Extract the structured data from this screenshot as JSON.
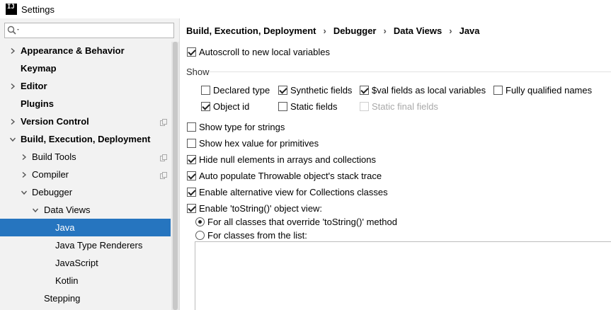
{
  "window": {
    "app_icon_text": "IJ",
    "title": "Settings"
  },
  "search": {
    "value": "",
    "placeholder": ""
  },
  "tree": {
    "items": [
      {
        "label": "Appearance & Behavior",
        "level": 0,
        "bold": true,
        "expander": "collapsed",
        "copy_icon": false,
        "selected": false
      },
      {
        "label": "Keymap",
        "level": 0,
        "bold": true,
        "expander": "none",
        "copy_icon": false,
        "selected": false
      },
      {
        "label": "Editor",
        "level": 0,
        "bold": true,
        "expander": "collapsed",
        "copy_icon": false,
        "selected": false
      },
      {
        "label": "Plugins",
        "level": 0,
        "bold": true,
        "expander": "none",
        "copy_icon": false,
        "selected": false
      },
      {
        "label": "Version Control",
        "level": 0,
        "bold": true,
        "expander": "collapsed",
        "copy_icon": true,
        "selected": false
      },
      {
        "label": "Build, Execution, Deployment",
        "level": 0,
        "bold": true,
        "expander": "expanded",
        "copy_icon": false,
        "selected": false
      },
      {
        "label": "Build Tools",
        "level": 1,
        "bold": false,
        "expander": "collapsed",
        "copy_icon": true,
        "selected": false
      },
      {
        "label": "Compiler",
        "level": 1,
        "bold": false,
        "expander": "collapsed",
        "copy_icon": true,
        "selected": false
      },
      {
        "label": "Debugger",
        "level": 1,
        "bold": false,
        "expander": "expanded",
        "copy_icon": false,
        "selected": false
      },
      {
        "label": "Data Views",
        "level": 2,
        "bold": false,
        "expander": "expanded",
        "copy_icon": false,
        "selected": false
      },
      {
        "label": "Java",
        "level": 3,
        "bold": false,
        "expander": "none",
        "copy_icon": false,
        "selected": true
      },
      {
        "label": "Java Type Renderers",
        "level": 3,
        "bold": false,
        "expander": "none",
        "copy_icon": false,
        "selected": false
      },
      {
        "label": "JavaScript",
        "level": 3,
        "bold": false,
        "expander": "none",
        "copy_icon": false,
        "selected": false
      },
      {
        "label": "Kotlin",
        "level": 3,
        "bold": false,
        "expander": "none",
        "copy_icon": false,
        "selected": false
      },
      {
        "label": "Stepping",
        "level": 2,
        "bold": false,
        "expander": "none",
        "copy_icon": false,
        "selected": false
      }
    ]
  },
  "breadcrumb": [
    "Build, Execution, Deployment",
    "Debugger",
    "Data Views",
    "Java"
  ],
  "breadcrumb_separator": "›",
  "options": {
    "autoscroll": {
      "label": "Autoscroll to new local variables",
      "checked": true
    },
    "show_label": "Show",
    "show_row1": [
      {
        "label": "Declared type",
        "checked": false
      },
      {
        "label": "Synthetic fields",
        "checked": true
      },
      {
        "label": "$val fields as local variables",
        "checked": true
      },
      {
        "label": "Fully qualified names",
        "checked": false
      }
    ],
    "show_row2": [
      {
        "label": "Object id",
        "checked": true,
        "disabled": false
      },
      {
        "label": "Static fields",
        "checked": false,
        "disabled": false
      },
      {
        "label": "Static final fields",
        "checked": false,
        "disabled": true
      }
    ],
    "general": [
      {
        "label": "Show type for strings",
        "checked": false
      },
      {
        "label": "Show hex value for primitives",
        "checked": false
      },
      {
        "label": "Hide null elements in arrays and collections",
        "checked": true
      },
      {
        "label": "Auto populate Throwable object's stack trace",
        "checked": true
      },
      {
        "label": "Enable alternative view for Collections classes",
        "checked": true
      },
      {
        "label": "Enable 'toString()' object view:",
        "checked": true
      }
    ],
    "tostring_radios": [
      {
        "label": "For all classes that override 'toString()' method",
        "checked": true
      },
      {
        "label": "For classes from the list:",
        "checked": false
      }
    ]
  },
  "colors": {
    "selection": "#2675bf",
    "left_panel_bg": "#f2f2f2",
    "disabled_text": "#a9a9a9"
  }
}
